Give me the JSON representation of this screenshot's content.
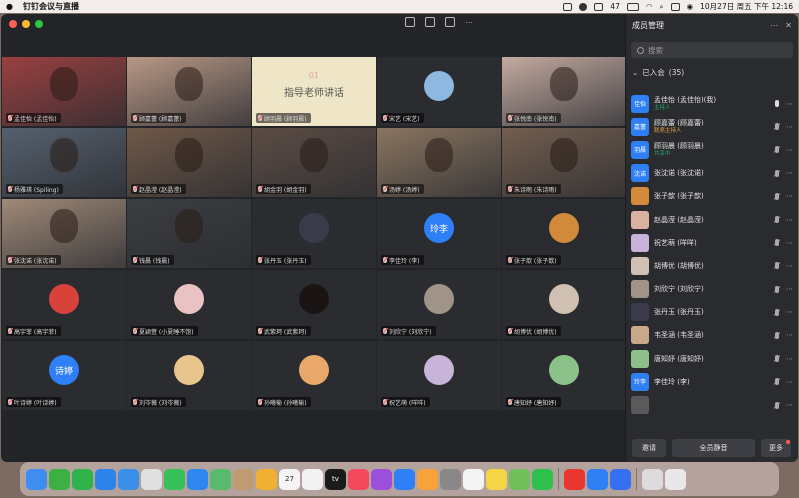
{
  "menubar": {
    "app": "钉钉会议与直播",
    "battery": "47",
    "datetime": "10月27日 周五 下午 12:16"
  },
  "colors": {
    "accent": "#2f7ff6",
    "mic_muted": "#ff5a52",
    "presenter": "#2aa36b",
    "speaking_tag": "#2aa36b"
  },
  "tiles": [
    {
      "name": "孟佳怡 (孟佳怡)",
      "kind": "photo",
      "bg": "#9a4040",
      "muted": true
    },
    {
      "name": "顾嘉蕾 (顾嘉蕾)",
      "kind": "photo",
      "bg": "#b89886",
      "muted": true
    },
    {
      "name": "顾羽晨 (顾羽晨)",
      "kind": "share",
      "bg": "#efe5c7",
      "muted": true
    },
    {
      "name": "宋艺 (宋艺)",
      "kind": "avatar",
      "bg": "#8fb8e0",
      "muted": true
    },
    {
      "name": "张悦南 (张悦南)",
      "kind": "photo",
      "bg": "#c3aaa0",
      "muted": true
    },
    {
      "name": "杨雅琪 (Spiling)",
      "kind": "photo",
      "bg": "#55606e",
      "muted": true
    },
    {
      "name": "赵晶滢 (赵晶滢)",
      "kind": "photo",
      "bg": "#6f5848",
      "muted": true
    },
    {
      "name": "胡金羽 (胡金羽)",
      "kind": "photo",
      "bg": "#5c4c44",
      "muted": true
    },
    {
      "name": "汤婷 (汤婷)",
      "kind": "photo",
      "bg": "#8a7560",
      "muted": true
    },
    {
      "name": "朱诗雨 (朱诗雨)",
      "kind": "photo",
      "bg": "#735e4f",
      "muted": true
    },
    {
      "name": "张沈诺 (张沈诺)",
      "kind": "photo",
      "bg": "#a08a78",
      "muted": true
    },
    {
      "name": "钱晨 (钱晨)",
      "kind": "photo",
      "bg": "#3b3d42",
      "muted": true
    },
    {
      "name": "张丹玉 (张丹玉)",
      "kind": "avatar",
      "bg": "#3a3a4a",
      "muted": true
    },
    {
      "name": "李佳玲 (李)",
      "kind": "text",
      "initials": "玲李",
      "bg": "#2f7ff6",
      "muted": true
    },
    {
      "name": "张子歆 (张子歆)",
      "kind": "avatar",
      "bg": "#d08a3a",
      "muted": true
    },
    {
      "name": "高宇菲 (高宇菲)",
      "kind": "avatar",
      "bg": "#d8423a",
      "muted": true
    },
    {
      "name": "夏颖萱 (小夏睡不饱)",
      "kind": "avatar",
      "bg": "#e9c3c3",
      "muted": true
    },
    {
      "name": "武紫珂 (武紫珂)",
      "kind": "avatar",
      "bg": "#1a1414",
      "muted": true
    },
    {
      "name": "刘欣宁 (刘欣宁)",
      "kind": "avatar",
      "bg": "#a09488",
      "muted": true
    },
    {
      "name": "胡博优 (胡博优)",
      "kind": "avatar",
      "bg": "#cfc0b2",
      "muted": true
    },
    {
      "name": "叶诗婷 (叶诗婷)",
      "kind": "text",
      "initials": "诗婷",
      "bg": "#2f7ff6",
      "muted": true
    },
    {
      "name": "刘岑薇 (刘岑薇)",
      "kind": "avatar",
      "bg": "#e8c58c",
      "muted": true
    },
    {
      "name": "孙曦榆 (孙曦榆)",
      "kind": "avatar",
      "bg": "#e7a86a",
      "muted": true
    },
    {
      "name": "祝艺萌 (咩咩)",
      "kind": "avatar",
      "bg": "#c7b4d8",
      "muted": true
    },
    {
      "name": "唐知妤 (唐知妤)",
      "kind": "avatar",
      "bg": "#8cc28a",
      "muted": true
    }
  ],
  "share_screen": {
    "num": "01",
    "text": "指导老师讲话"
  },
  "panel": {
    "title": "成员管理",
    "search_placeholder": "搜索",
    "joined_label": "已入会",
    "joined_count": "(35)",
    "members": [
      {
        "name": "孟佳怡 (孟佳怡)(我)",
        "role": "主持人",
        "avatar": "佳怡",
        "avbg": "#2f7ff6",
        "mic": "on"
      },
      {
        "name": "顾嘉蕾 (顾嘉蕾)",
        "role": "联席主持人",
        "avatar": "嘉蕾",
        "avbg": "#2f7ff6",
        "mic": "muted"
      },
      {
        "name": "顾羽晨 (顾羽晨)",
        "role": "共享中",
        "avatar": "羽晨",
        "avbg": "#2f7ff6",
        "mic": "muted"
      },
      {
        "name": "张沈诺 (张沈诺)",
        "role": "",
        "avatar": "沈诺",
        "avbg": "#2f7ff6",
        "mic": "muted"
      },
      {
        "name": "张子歆 (张子歆)",
        "role": "",
        "avatar": "",
        "avbg": "#d08a3a",
        "mic": "muted"
      },
      {
        "name": "赵晶滢 (赵晶滢)",
        "role": "",
        "avatar": "",
        "avbg": "#d9b3a0",
        "mic": "muted"
      },
      {
        "name": "祝艺萌 (咩咩)",
        "role": "",
        "avatar": "",
        "avbg": "#c7b4d8",
        "mic": "muted"
      },
      {
        "name": "胡博优 (胡博优)",
        "role": "",
        "avatar": "",
        "avbg": "#cfc0b2",
        "mic": "muted"
      },
      {
        "name": "刘欣宁 (刘欣宁)",
        "role": "",
        "avatar": "",
        "avbg": "#a09488",
        "mic": "muted"
      },
      {
        "name": "张丹玉 (张丹玉)",
        "role": "",
        "avatar": "",
        "avbg": "#3a3a4a",
        "mic": "muted"
      },
      {
        "name": "韦圣涵 (韦圣涵)",
        "role": "",
        "avatar": "",
        "avbg": "#c9a98a",
        "mic": "muted"
      },
      {
        "name": "唐知妤 (唐知妤)",
        "role": "",
        "avatar": "",
        "avbg": "#8cc28a",
        "mic": "muted"
      },
      {
        "name": "李佳玲 (李)",
        "role": "",
        "avatar": "玲李",
        "avbg": "#2f7ff6",
        "mic": "muted"
      },
      {
        "name": "",
        "role": "",
        "avatar": "",
        "avbg": "#5a5a5a",
        "mic": "muted"
      }
    ],
    "buttons": {
      "invite": "邀请",
      "mute_all": "全员静音",
      "more": "更多"
    }
  },
  "dock": [
    {
      "name": "finder-icon",
      "bg": "#3d8ef0",
      "label": ""
    },
    {
      "name": "numbers-icon",
      "bg": "#3cb043",
      "label": ""
    },
    {
      "name": "facetime-icon",
      "bg": "#2fb34a",
      "label": ""
    },
    {
      "name": "safari-icon",
      "bg": "#2c83e9",
      "label": ""
    },
    {
      "name": "mail-icon",
      "bg": "#3a8fe8",
      "label": ""
    },
    {
      "name": "launchpad-icon",
      "bg": "#e0e0e0",
      "label": ""
    },
    {
      "name": "messages-icon",
      "bg": "#36c15a",
      "label": ""
    },
    {
      "name": "app-store-icon",
      "bg": "#2f86f0",
      "label": ""
    },
    {
      "name": "maps-icon",
      "bg": "#5aba6c",
      "label": ""
    },
    {
      "name": "contacts-icon",
      "bg": "#c09a70",
      "label": ""
    },
    {
      "name": "photos-icon",
      "bg": "#f0b030",
      "label": ""
    },
    {
      "name": "calendar-icon",
      "bg": "#f4f4f4",
      "label": "27"
    },
    {
      "name": "reminders-icon",
      "bg": "#f2f2f2",
      "label": ""
    },
    {
      "name": "apple-tv-icon",
      "bg": "#1a1a1a",
      "label": "tv"
    },
    {
      "name": "music-icon",
      "bg": "#f24a5c",
      "label": ""
    },
    {
      "name": "podcasts-icon",
      "bg": "#9c4fd8",
      "label": ""
    },
    {
      "name": "keynote-icon",
      "bg": "#2f7ff6",
      "label": ""
    },
    {
      "name": "pages-icon",
      "bg": "#f7a23a",
      "label": ""
    },
    {
      "name": "settings-icon",
      "bg": "#888",
      "label": ""
    },
    {
      "name": "textedit-icon",
      "bg": "#f4f4f4",
      "label": ""
    },
    {
      "name": "notes-icon",
      "bg": "#f5d547",
      "label": ""
    },
    {
      "name": "preview-icon",
      "bg": "#6fbf5a",
      "label": ""
    },
    {
      "name": "wechat-icon",
      "bg": "#2fbf4c",
      "label": ""
    },
    {
      "name": "wps-icon",
      "bg": "#e9362f",
      "label": ""
    },
    {
      "name": "dingtalk-icon",
      "bg": "#2f7ff6",
      "label": ""
    },
    {
      "name": "zoom-icon",
      "bg": "#3470f0",
      "label": ""
    },
    {
      "name": "downloads-icon",
      "bg": "#dcdcdc",
      "label": ""
    },
    {
      "name": "trash-icon",
      "bg": "#e8e8e8",
      "label": ""
    }
  ]
}
